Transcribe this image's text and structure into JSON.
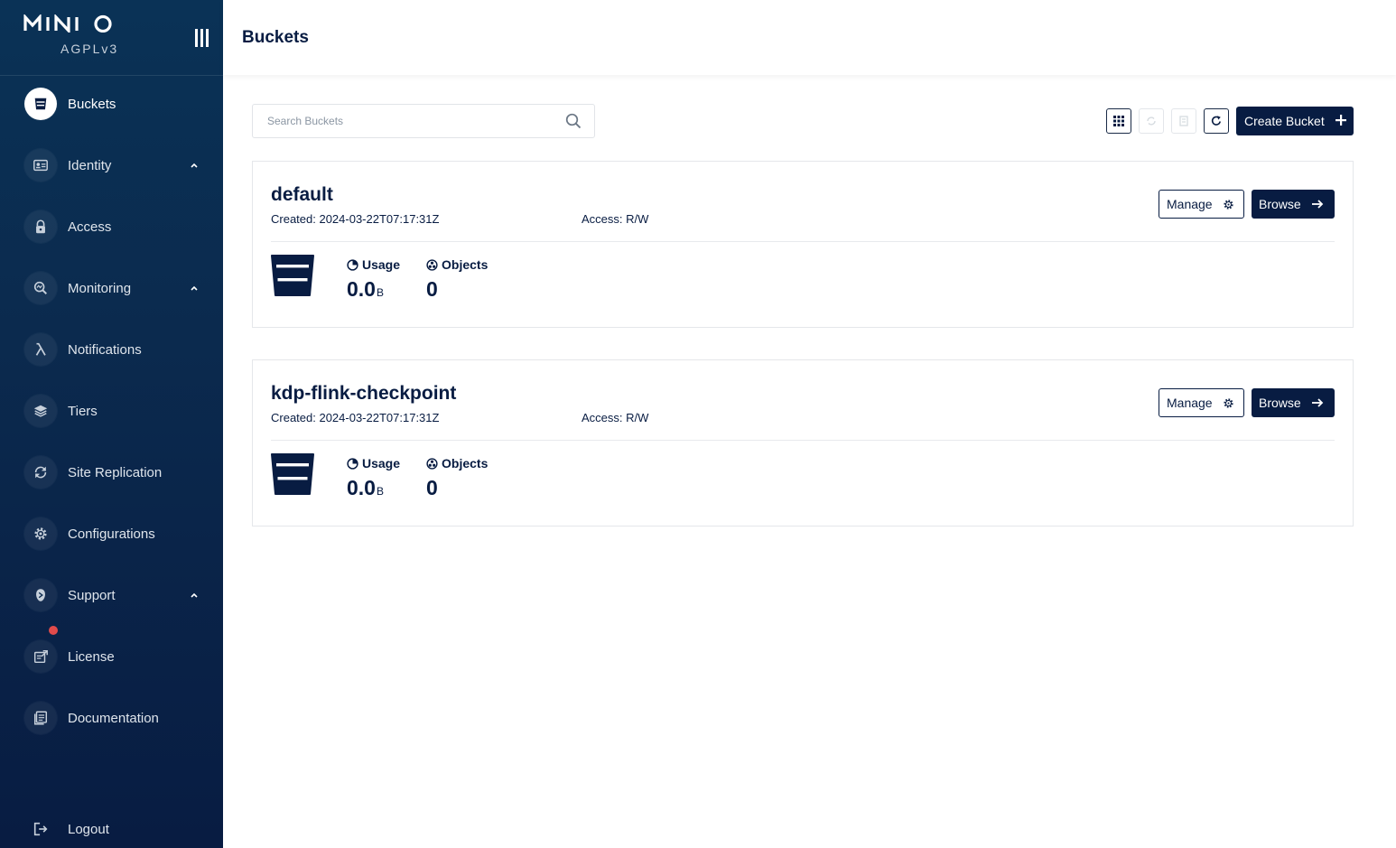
{
  "brand": {
    "logo_text": "MINIO",
    "license": "AGPLv3"
  },
  "nav": {
    "items": [
      {
        "label": "Buckets",
        "icon": "bucket-icon",
        "active": true
      },
      {
        "label": "Identity",
        "icon": "identity-icon",
        "expandable": true
      },
      {
        "label": "Access",
        "icon": "lock-icon"
      },
      {
        "label": "Monitoring",
        "icon": "monitoring-icon",
        "expandable": true
      },
      {
        "label": "Notifications",
        "icon": "lambda-icon"
      },
      {
        "label": "Tiers",
        "icon": "layers-icon"
      },
      {
        "label": "Site Replication",
        "icon": "replication-icon"
      },
      {
        "label": "Configurations",
        "icon": "gear-icon"
      },
      {
        "label": "Support",
        "icon": "support-icon",
        "expandable": true
      },
      {
        "label": "License",
        "icon": "license-icon",
        "has_badge": true
      },
      {
        "label": "Documentation",
        "icon": "documentation-icon"
      }
    ],
    "logout": "Logout"
  },
  "header": {
    "title": "Buckets"
  },
  "toolbar": {
    "search_placeholder": "Search Buckets",
    "create_label": "Create Bucket"
  },
  "buckets": [
    {
      "name": "default",
      "created": "Created: 2024-03-22T07:17:31Z",
      "access": "Access: R/W",
      "manage_label": "Manage",
      "browse_label": "Browse",
      "usage_label": "Usage",
      "usage_value": "0.0",
      "usage_unit": "B",
      "objects_label": "Objects",
      "objects_value": "0"
    },
    {
      "name": "kdp-flink-checkpoint",
      "created": "Created: 2024-03-22T07:17:31Z",
      "access": "Access: R/W",
      "manage_label": "Manage",
      "browse_label": "Browse",
      "usage_label": "Usage",
      "usage_value": "0.0",
      "usage_unit": "B",
      "objects_label": "Objects",
      "objects_value": "0"
    }
  ],
  "colors": {
    "primary": "#081c42",
    "sidebar": "#0b2a4e",
    "badge": "#e14b4b"
  }
}
